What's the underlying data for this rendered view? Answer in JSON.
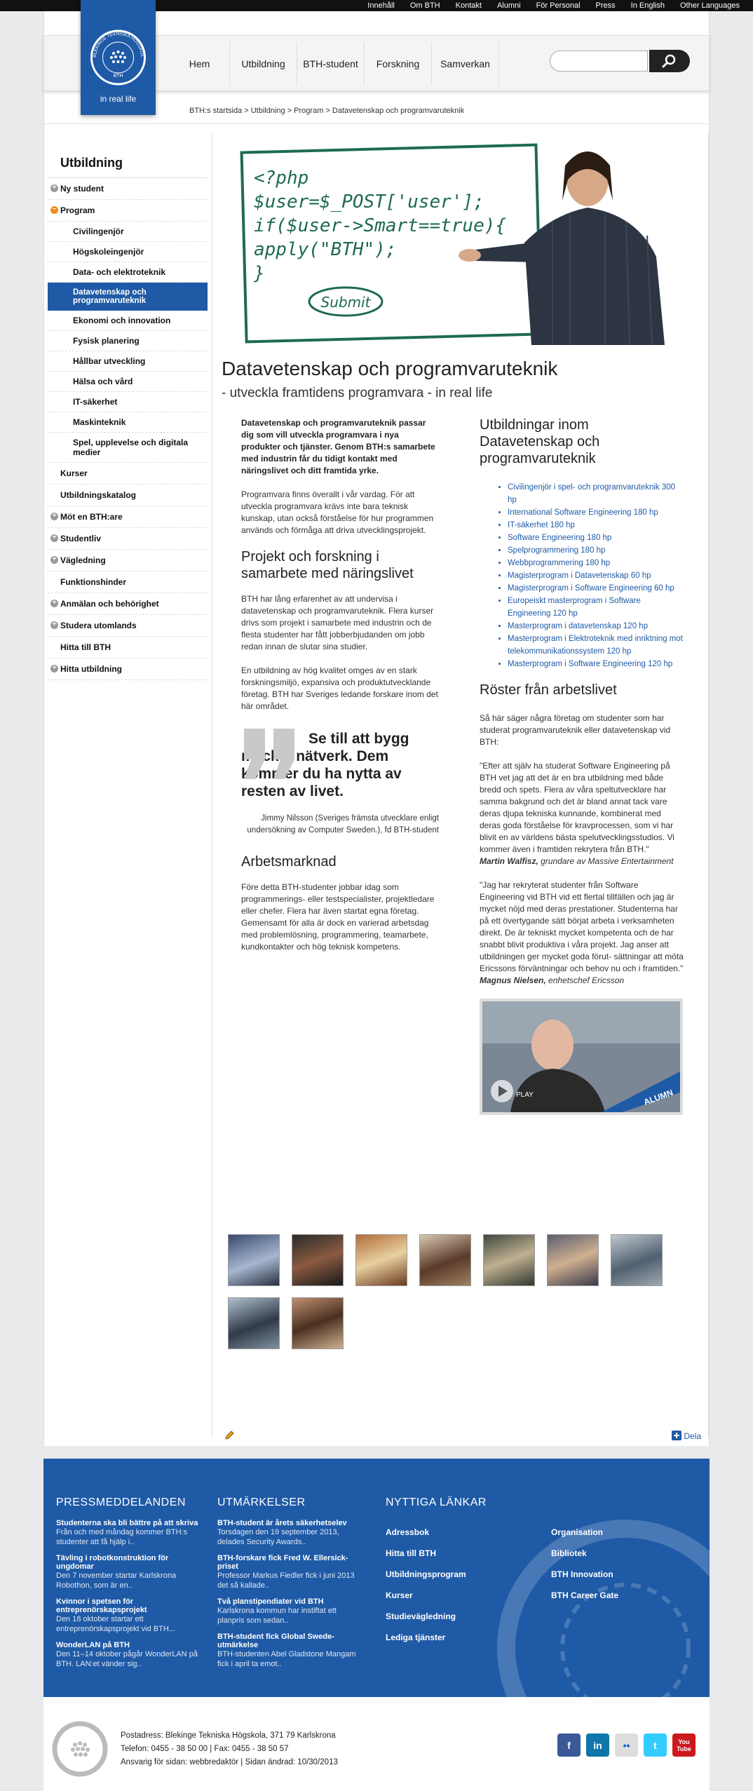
{
  "topnav": [
    "Innehåll",
    "Om BTH",
    "Kontakt",
    "Alumni",
    "För Personal",
    "Press",
    "In English",
    "Other Languages"
  ],
  "logo": {
    "arc_text": "BLEKINGE TEKNISKA HÖGSKOLA",
    "initials": "BTH",
    "tagline": "in real life"
  },
  "mainnav": [
    "Hem",
    "Utbildning",
    "BTH-student",
    "Forskning",
    "Samverkan"
  ],
  "breadcrumb": "BTH:s startsida > Utbildning > Program > Datavetenskap och programvaruteknik",
  "sidebar": {
    "title": "Utbildning",
    "items": [
      {
        "label": "Ny student",
        "level": 0,
        "icon": "plus"
      },
      {
        "label": "Program",
        "level": 0,
        "icon": "minus"
      },
      {
        "label": "Civilingenjör",
        "level": 1
      },
      {
        "label": "Högskoleingenjör",
        "level": 1
      },
      {
        "label": "Data- och elektroteknik",
        "level": 1
      },
      {
        "label": "Datavetenskap och programvaruteknik",
        "level": 2,
        "active": true
      },
      {
        "label": "Ekonomi och innovation",
        "level": 1
      },
      {
        "label": "Fysisk planering",
        "level": 1
      },
      {
        "label": "Hållbar utveckling",
        "level": 1
      },
      {
        "label": "Hälsa och vård",
        "level": 1
      },
      {
        "label": "IT-säkerhet",
        "level": 1
      },
      {
        "label": "Maskinteknik",
        "level": 1
      },
      {
        "label": "Spel, upplevelse och digitala medier",
        "level": 1
      },
      {
        "label": "Kurser",
        "level": 0
      },
      {
        "label": "Utbildningskatalog",
        "level": 0
      },
      {
        "label": "Möt en BTH:are",
        "level": 0,
        "icon": "plus"
      },
      {
        "label": "Studentliv",
        "level": 0,
        "icon": "plus"
      },
      {
        "label": "Vägledning",
        "level": 0,
        "icon": "plus"
      },
      {
        "label": "Funktionshinder",
        "level": 0
      },
      {
        "label": "Anmälan och behörighet",
        "level": 0,
        "icon": "plus"
      },
      {
        "label": "Studera utomlands",
        "level": 0,
        "icon": "plus"
      },
      {
        "label": "Hitta till BTH",
        "level": 0
      },
      {
        "label": "Hitta utbildning",
        "level": 0,
        "icon": "plus"
      }
    ]
  },
  "hero": {
    "code_lines": [
      "<?php",
      "$user=$_POST['user'];",
      "if($user->Smart==true){",
      "apply(\"BTH\");",
      "}"
    ],
    "button": "Submit"
  },
  "page": {
    "title": "Datavetenskap och programvaruteknik",
    "subtitle": "- utveckla framtidens programvara - in real life",
    "lead": "Datavetenskap och programvaruteknik passar dig som vill utveckla programvara i nya produkter och tjänster. Genom BTH:s samarbete med industrin får du tidigt kontakt med näringslivet och ditt framtida yrke.",
    "p1": "Programvara finns överallt i vår vardag. För att utveckla programvara krävs inte bara teknisk kunskap, utan också förståelse för hur programmen används och förmåga att driva utvecklingsprojekt.",
    "h_projekt": "Projekt och forskning i samarbete med näringslivet",
    "p2": "BTH har lång erfarenhet av att undervisa i datavetenskap och programvaruteknik. Flera kurser drivs som projekt i samarbete med industrin och de flesta studenter har fått jobberbjudanden om jobb redan innan de slutar sina studier.",
    "p3": "En utbildning av hög kvalitet omges av en stark forskningsmiljö, expansiva och produktutvecklande företag. BTH har Sveriges ledande forskare inom det här området.",
    "quote": "Se till att bygg mycket nätverk. Dem kommer du ha nytta av resten av livet.",
    "quote_source": "Jimmy Nilsson (Sveriges främsta utvecklare enligt undersökning av Computer Sweden.), fd BTH-student",
    "h_arbets": "Arbetsmarknad",
    "p4": "Före detta BTH-studenter jobbar idag som programmerings- eller testspecialister, projektledare eller chefer. Flera har även startat egna företag. Gemensamt för alla är dock en varierad arbetsdag med problemlösning, programmering, teamarbete, kundkontakter och hög teknisk kompetens."
  },
  "right": {
    "heading": "Utbildningar inom Datavetenskap och programvaruteknik",
    "programs": [
      "Civilingenjör i spel- och programvaruteknik 300 hp",
      "International Software Engineering 180 hp",
      "IT-säkerhet 180 hp",
      "Software Engineering 180 hp",
      "Spelprogrammering 180 hp",
      "Webbprogrammering 180 hp",
      "Magisterprogram i Datavetenskap 60 hp",
      "Magisterprogram i Software Engineering 60 hp",
      "Europeiskt masterprogram i Software Engineering 120 hp",
      "Masterprogram i datavetenskap 120 hp",
      "Masterprogram i Elektroteknik med inriktning mot telekommunikationssystem 120 hp",
      "Masterprogram i Software Engineering 120 hp"
    ],
    "h_roster": "Röster från arbetslivet",
    "intro": "Så här säger några företag om studenter som har studerat programvaruteknik eller datavetenskap vid BTH:",
    "q1": "\"Efter att själv ha studerat Software Engineering på BTH vet jag att det är en bra utbildning med både bredd och spets. Flera av våra speltutvecklare har samma bakgrund och det är bland annat tack vare deras djupa tekniska kunnande, kombinerat med deras goda förståelse för kravprocessen, som vi har blivit en av världens bästa spelutvecklingsstudios. Vi kommer även i framtiden rekrytera från BTH.\"",
    "q1_name": "Martin Walfisz,",
    "q1_role": " grundare av Massive Entertainment",
    "q2": "\"Jag har rekryterat studenter från Software Engineering vid BTH vid ett flertal tillfällen och jag är mycket nöjd med deras prestationer. Studenterna har på ett övertygande sätt börjat arbeta i verksamheten direkt. De är tekniskt mycket kompetenta och de har snabbt blivit produktiva i våra projekt. Jag anser att utbildningen ger mycket goda förut- sättningar att möta Ericssons förväntningar och behov nu och i framtiden.\"",
    "q2_name": "Magnus Nielsen,",
    "q2_role": " enhetschef Ericsson",
    "video_play": "PLAY",
    "video_badge": "ALUMN"
  },
  "share": "Dela",
  "footer": {
    "press_title": "PRESSMEDDELANDEN",
    "press": [
      {
        "title": "Studenterna ska bli bättre på att skriva",
        "text": "Från och med måndag kommer BTH:s studenter att få hjälp i.."
      },
      {
        "title": "Tävling i robotkonstruktion för ungdomar",
        "text": "Den 7 november startar Karlskrona Robothon, som är en.."
      },
      {
        "title": "Kvinnor i spetsen för entreprenörskapsprojekt",
        "text": "Den 18 oktober startar ett entreprenörskapsprojekt vid BTH..."
      },
      {
        "title": "WonderLAN på BTH",
        "text": "Den 11–14 oktober pågår WonderLAN på BTH. LAN:et vänder sig.."
      }
    ],
    "awards_title": "UTMÄRKELSER",
    "awards": [
      {
        "title": "BTH-student är årets säkerhetselev",
        "text": "Torsdagen den 19 september 2013, delades Security Awards.."
      },
      {
        "title": "BTH-forskare fick Fred W. Ellersick-priset",
        "text": "Professor Markus Fiedler fick i juni 2013 det så kallade.."
      },
      {
        "title": "Två planstipendiater vid BTH",
        "text": "Karlskrona kommun har instiftat ett planpris som sedan.."
      },
      {
        "title": "BTH-student fick Global Swede-utmärkelse",
        "text": "BTH-studenten Abel Gladstone Mangam fick i april ta emot.."
      }
    ],
    "links_title": "NYTTIGA LÄNKAR",
    "links_a": [
      "Adressbok",
      "Hitta till BTH",
      "Utbildningsprogram",
      "Kurser",
      "Studievägledning",
      "Lediga tjänster"
    ],
    "links_b": [
      "Organisation",
      "Bibliotek",
      "BTH Innovation",
      "BTH Career Gate"
    ]
  },
  "bottom": {
    "address": "Postadress: Blekinge Tekniska Högskola, 371 79 Karlskrona",
    "phone": "Telefon: 0455 - 38 50 00 | Fax: 0455 - 38 50 57",
    "resp": "Ansvarig för sidan: webbredaktör | Sidan ändrad: 10/30/2013",
    "social": [
      "f",
      "in",
      "••",
      "t",
      "You Tube"
    ]
  }
}
